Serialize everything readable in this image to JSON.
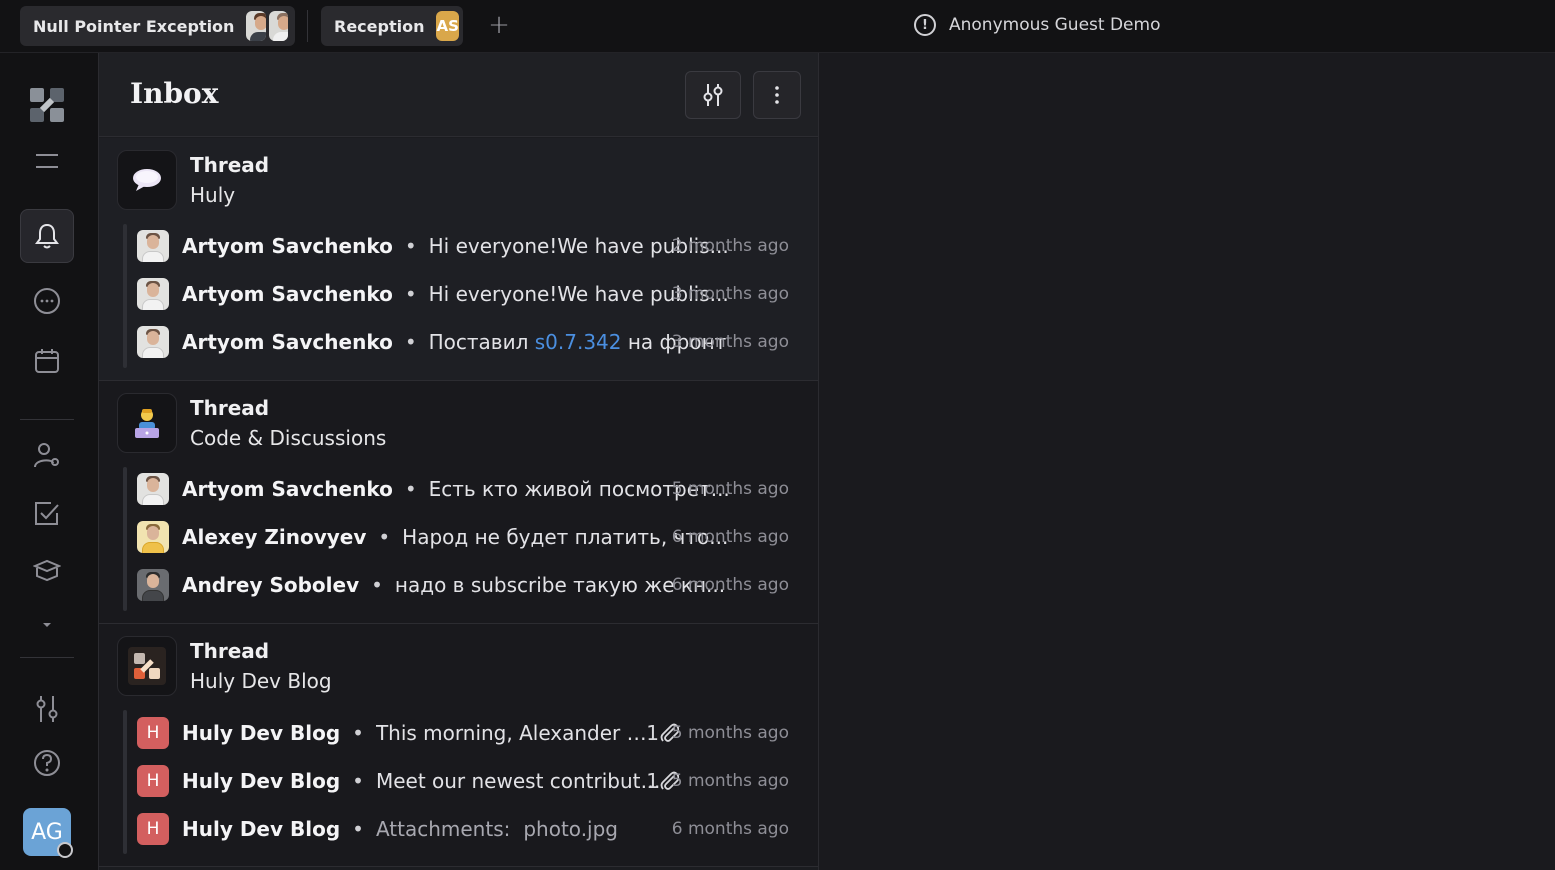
{
  "topbar": {
    "tabs": [
      {
        "label": "Null Pointer Exception"
      },
      {
        "label": "Reception",
        "badge": "AS"
      }
    ],
    "guest_label": "Anonymous Guest Demo"
  },
  "rail": {
    "icons": [
      "logo-icon",
      "menu-icon",
      "bell-icon",
      "chat-icon",
      "calendar-icon",
      "contacts-icon",
      "checkbox-icon",
      "box-icon",
      "caret-down-icon",
      "sliders-icon",
      "help-icon"
    ],
    "user_initials": "AG"
  },
  "inbox": {
    "title": "Inbox",
    "groups": [
      {
        "title": "Thread",
        "subtitle": "Huly",
        "messages": [
          {
            "name": "Artyom Savchenko",
            "text": "Hi everyone!We have publis...",
            "time": "2 months ago"
          },
          {
            "name": "Artyom Savchenko",
            "text": "Hi everyone!We have publis...",
            "time": "3 months ago"
          },
          {
            "name": "Artyom Savchenko",
            "text_pre": "Поставил ",
            "text_link": "s0.7.342",
            "text_post": " на фронт",
            "time": "3 months ago"
          }
        ]
      },
      {
        "title": "Thread",
        "subtitle": "Code & Discussions",
        "messages": [
          {
            "name": "Artyom Savchenko",
            "text": "Есть кто живой посмотрет...",
            "time": "5 months ago"
          },
          {
            "name": "Alexey Zinovyev",
            "text": "Народ не будет платить, что...",
            "time": "6 months ago"
          },
          {
            "name": "Andrey Sobolev",
            "text": "надо в subscribe такую же кн...",
            "time": "6 months ago"
          }
        ]
      },
      {
        "title": "Thread",
        "subtitle": "Huly Dev Blog",
        "messages": [
          {
            "name": "Huly Dev Blog",
            "avatar_letter": "H",
            "text": "This morning, Alexander On...",
            "attachments": "1",
            "time": "5 months ago"
          },
          {
            "name": "Huly Dev Blog",
            "avatar_letter": "H",
            "text": "Meet our newest contributor...",
            "attachments": "1",
            "time": "5 months ago"
          },
          {
            "name": "Huly Dev Blog",
            "avatar_letter": "H",
            "text_label": "Attachments:",
            "text_file": "photo.jpg",
            "time": "6 months ago"
          }
        ]
      }
    ]
  },
  "colors": {
    "accent_link": "#4b8fe0",
    "badge_as": "#d9a74a",
    "avatar_ag": "#6ba3d6",
    "avatar_h": "#d35f5f"
  }
}
